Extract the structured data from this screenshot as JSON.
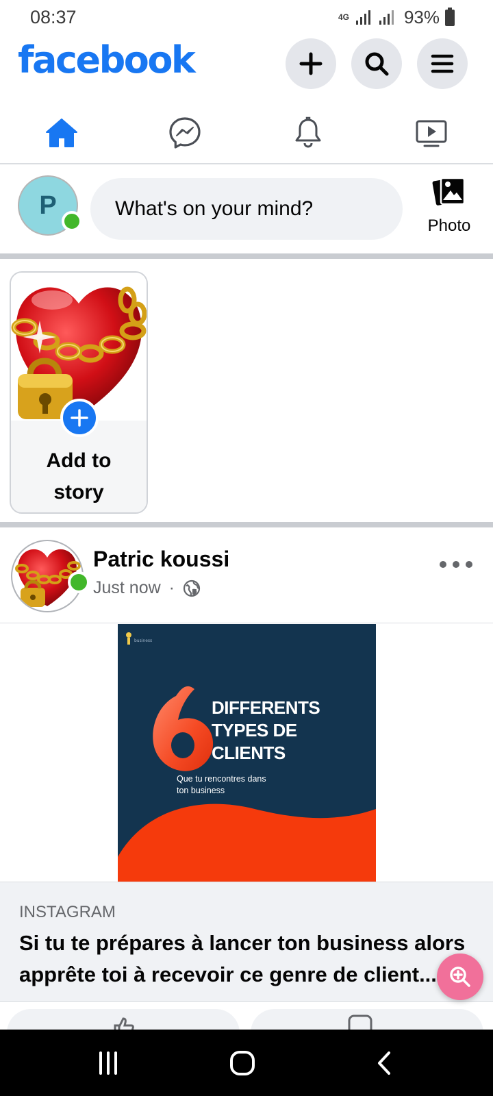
{
  "status_bar": {
    "time": "08:37",
    "network": "4G",
    "battery": "93%"
  },
  "header": {
    "logo": "facebook",
    "brand_color": "#1877f2",
    "buttons": [
      "plus-icon",
      "search-icon",
      "menu-icon"
    ]
  },
  "nav_tabs": [
    {
      "name": "home",
      "icon": "home-icon",
      "active": true
    },
    {
      "name": "messenger",
      "icon": "messenger-icon",
      "active": false
    },
    {
      "name": "notifications",
      "icon": "bell-icon",
      "active": false
    },
    {
      "name": "watch",
      "icon": "video-icon",
      "active": false
    }
  ],
  "composer": {
    "avatar_initial": "P",
    "placeholder": "What's on your mind?",
    "photo_label": "Photo"
  },
  "story": {
    "add_label_line1": "Add to",
    "add_label_line2": "story"
  },
  "post": {
    "author": "Patric koussi",
    "time": "Just now",
    "separator": "·",
    "privacy_icon": "globe-icon",
    "image": {
      "number": "6",
      "headline_line1": "DIFFERENTS",
      "headline_line2": "TYPES DE",
      "headline_line3": "CLIENTS",
      "sub_line1": "Que tu rencontres dans",
      "sub_line2": "ton business"
    },
    "link": {
      "source": "INSTAGRAM",
      "title_line1": "Si tu te prépares à lancer ton business alors",
      "title_line2": "apprête toi à recevoir ce genre de client..."
    }
  },
  "colors": {
    "online": "#42b72a",
    "fab": "#f1709a",
    "post_bg": "#13344f",
    "post_accent": "#f53a0c"
  }
}
